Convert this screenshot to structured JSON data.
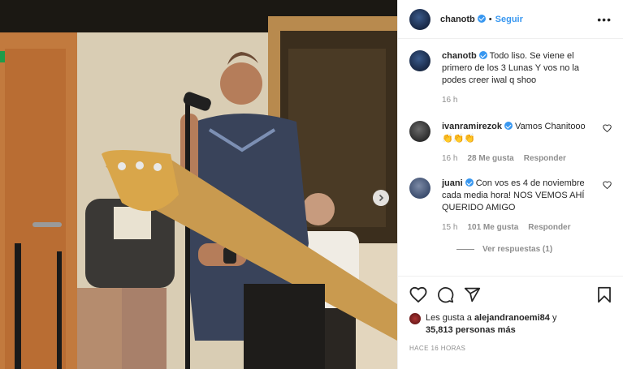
{
  "post": {
    "author": "chanotb",
    "follow_label": "Seguir",
    "more_label": "•••"
  },
  "caption": {
    "author": "chanotb",
    "text": "Todo liso. Se viene el primero de los 3 Lunas Y vos no la podes creer iwal q shoo",
    "time": "16 h"
  },
  "comments": [
    {
      "author": "ivanramirezok",
      "text": "Vamos Chanitooo👏👏👏",
      "time": "16 h",
      "likes": "28 Me gusta",
      "reply_label": "Responder"
    },
    {
      "author": "juani",
      "text": "Con vos es 4 de noviembre cada media hora! NOS VEMOS AHÍ QUERIDO AMIGO",
      "time": "15 h",
      "likes": "101 Me gusta",
      "reply_label": "Responder"
    }
  ],
  "replies_label": "Ver respuestas (1)",
  "likes": {
    "prefix": "Les gusta a",
    "user": "alejandranoemi84",
    "connector": "y",
    "others": "35,813 personas más"
  },
  "timeago": "HACE 16 HORAS",
  "icons": {
    "heart": "heart-icon",
    "comment": "comment-icon",
    "share": "share-icon",
    "save": "bookmark-icon",
    "next": "chevron-right-icon"
  }
}
